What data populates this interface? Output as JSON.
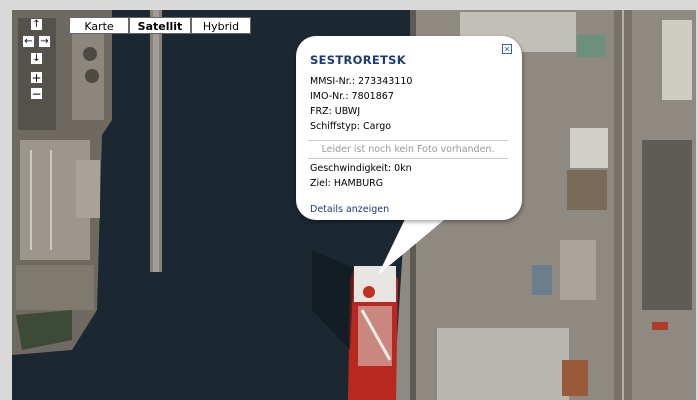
{
  "map_controls": {
    "map_types": [
      "Karte",
      "Satellit",
      "Hybrid"
    ],
    "active_map_type": "Satellit",
    "pan_up": "↑",
    "pan_left": "←",
    "pan_right": "→",
    "pan_down": "↓",
    "zoom_in": "+",
    "zoom_out": "−"
  },
  "info_window": {
    "close": "✕",
    "ship_name": "SESTRORETSK",
    "mmsi": "MMSI-Nr.: 273343110",
    "imo": "IMO-Nr.: 7801867",
    "frz": "FRZ: UBWJ",
    "ship_type": "Schiffstyp: Cargo",
    "photo_note": "Leider ist noch kein Foto vorhanden.",
    "speed": "Geschwindigkeit: 0kn",
    "destination": "Ziel: HAMBURG",
    "details_link": "Details anzeigen"
  },
  "colors": {
    "water": "#1a2630",
    "ship_hull": "#b9281f",
    "link": "#1d3a77"
  }
}
